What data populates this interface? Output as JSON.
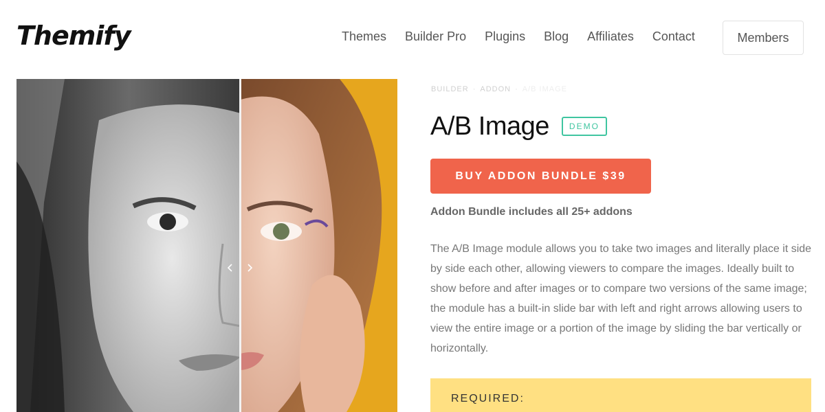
{
  "header": {
    "logo": "Themify",
    "nav": [
      "Themes",
      "Builder Pro",
      "Plugins",
      "Blog",
      "Affiliates",
      "Contact"
    ],
    "members_label": "Members"
  },
  "breadcrumb": {
    "items": [
      "BUILDER",
      "ADDON",
      "A/B IMAGE"
    ]
  },
  "product": {
    "title": "A/B Image",
    "badge": "DEMO",
    "buy_label": "BUY ADDON BUNDLE $39",
    "bundle_note": "Addon Bundle includes all 25+ addons",
    "description": "The A/B Image module allows you to take two images and literally place it side by side each other, allowing viewers to compare the images. Ideally built to show before and after images or to compare two versions of the same image; the module has a built-in slide bar with left and right arrows allowing users to view the entire image or a portion of the image by sliding the bar vertically or horizontally.",
    "required_label": "REQUIRED:"
  },
  "colors": {
    "accent": "#f0644b",
    "badge": "#3fc5a0",
    "required_bg": "#ffe082"
  },
  "comparison": {
    "slider_position": 0.59
  }
}
